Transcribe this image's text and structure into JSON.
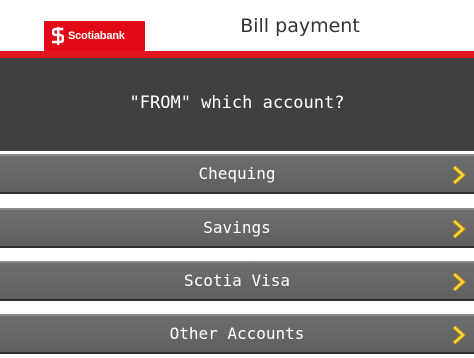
{
  "header": {
    "brand": "Scotiabank",
    "title": "Bill payment"
  },
  "prompt": "\"FROM\" which account?",
  "options": [
    {
      "label": "Chequing",
      "icon": "chevron-right-icon"
    },
    {
      "label": "Savings",
      "icon": "chevron-right-icon"
    },
    {
      "label": "Scotia Visa",
      "icon": "chevron-right-icon"
    },
    {
      "label": "Other Accounts",
      "icon": "chevron-right-icon"
    }
  ],
  "colors": {
    "brand_red": "#e20a16",
    "panel": "#404040",
    "option_bar": "#666666",
    "chevron": "#f2c200"
  }
}
